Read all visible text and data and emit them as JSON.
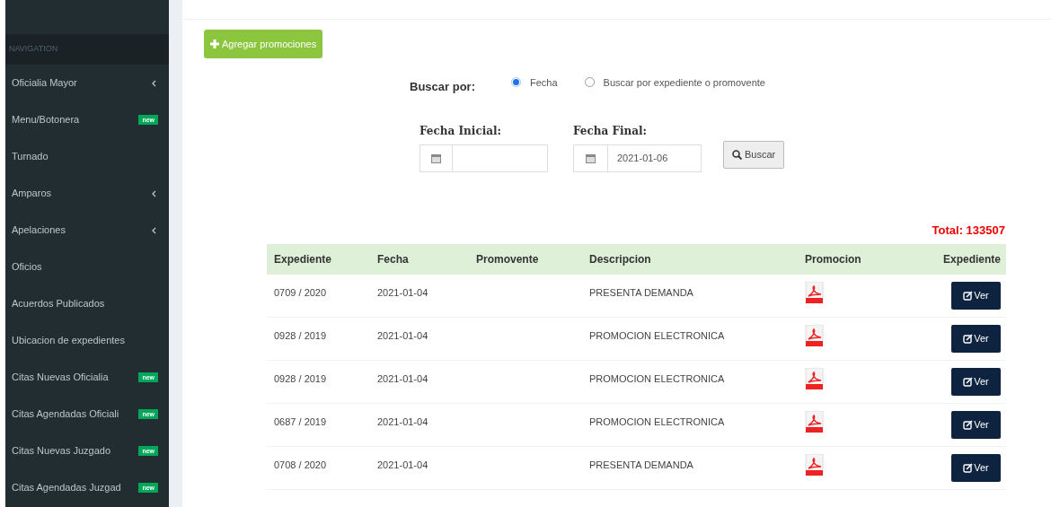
{
  "sidebar": {
    "header": "NAVIGATION",
    "items": [
      {
        "label": "Oficialia Mayor",
        "kind": "submenu"
      },
      {
        "label": "Menu/Botonera",
        "kind": "badge",
        "badge": "new"
      },
      {
        "label": "Turnado",
        "kind": "plain"
      },
      {
        "label": "Amparos",
        "kind": "submenu"
      },
      {
        "label": "Apelaciones",
        "kind": "submenu"
      },
      {
        "label": "Oficios",
        "kind": "plain"
      },
      {
        "label": "Acuerdos Publicados",
        "kind": "plain"
      },
      {
        "label": "Ubicacion de expedientes",
        "kind": "plain"
      },
      {
        "label": "Citas Nuevas Oficialia",
        "kind": "badge",
        "badge": "new"
      },
      {
        "label": "Citas Agendadas Oficiali",
        "kind": "badge",
        "badge": "new"
      },
      {
        "label": "Citas Nuevas Juzgado",
        "kind": "badge",
        "badge": "new"
      },
      {
        "label": "Citas Agendadas Juzgad",
        "kind": "badge",
        "badge": "new"
      }
    ]
  },
  "add_button": "Agregar promociones",
  "search_by": {
    "label": "Buscar por:",
    "options": [
      {
        "label": "Fecha",
        "selected": true
      },
      {
        "label": "Buscar por expediente o promovente",
        "selected": false
      }
    ]
  },
  "date_from": {
    "label": "Fecha Inicial:"
  },
  "date_to": {
    "label": "Fecha Final:",
    "value": "2021-01-06"
  },
  "search_button": "Buscar",
  "total": "Total: 133507",
  "table": {
    "columns": [
      "Expediente",
      "Fecha",
      "Promovente",
      "Descripcion",
      "Promocion",
      "Expediente"
    ],
    "rows": [
      {
        "expediente": "0709 / 2020",
        "fecha": "2021-01-04",
        "descripcion": "PRESENTA DEMANDA",
        "action": "Ver"
      },
      {
        "expediente": "0928 / 2019",
        "fecha": "2021-01-04",
        "descripcion": "PROMOCION ELECTRONICA",
        "action": "Ver"
      },
      {
        "expediente": "0928 / 2019",
        "fecha": "2021-01-04",
        "descripcion": "PROMOCION ELECTRONICA",
        "action": "Ver"
      },
      {
        "expediente": "0687 / 2019",
        "fecha": "2021-01-04",
        "descripcion": "PROMOCION ELECTRONICA",
        "action": "Ver"
      },
      {
        "expediente": "0708 / 2020",
        "fecha": "2021-01-04",
        "descripcion": "PRESENTA DEMANDA",
        "action": "Ver"
      }
    ]
  }
}
